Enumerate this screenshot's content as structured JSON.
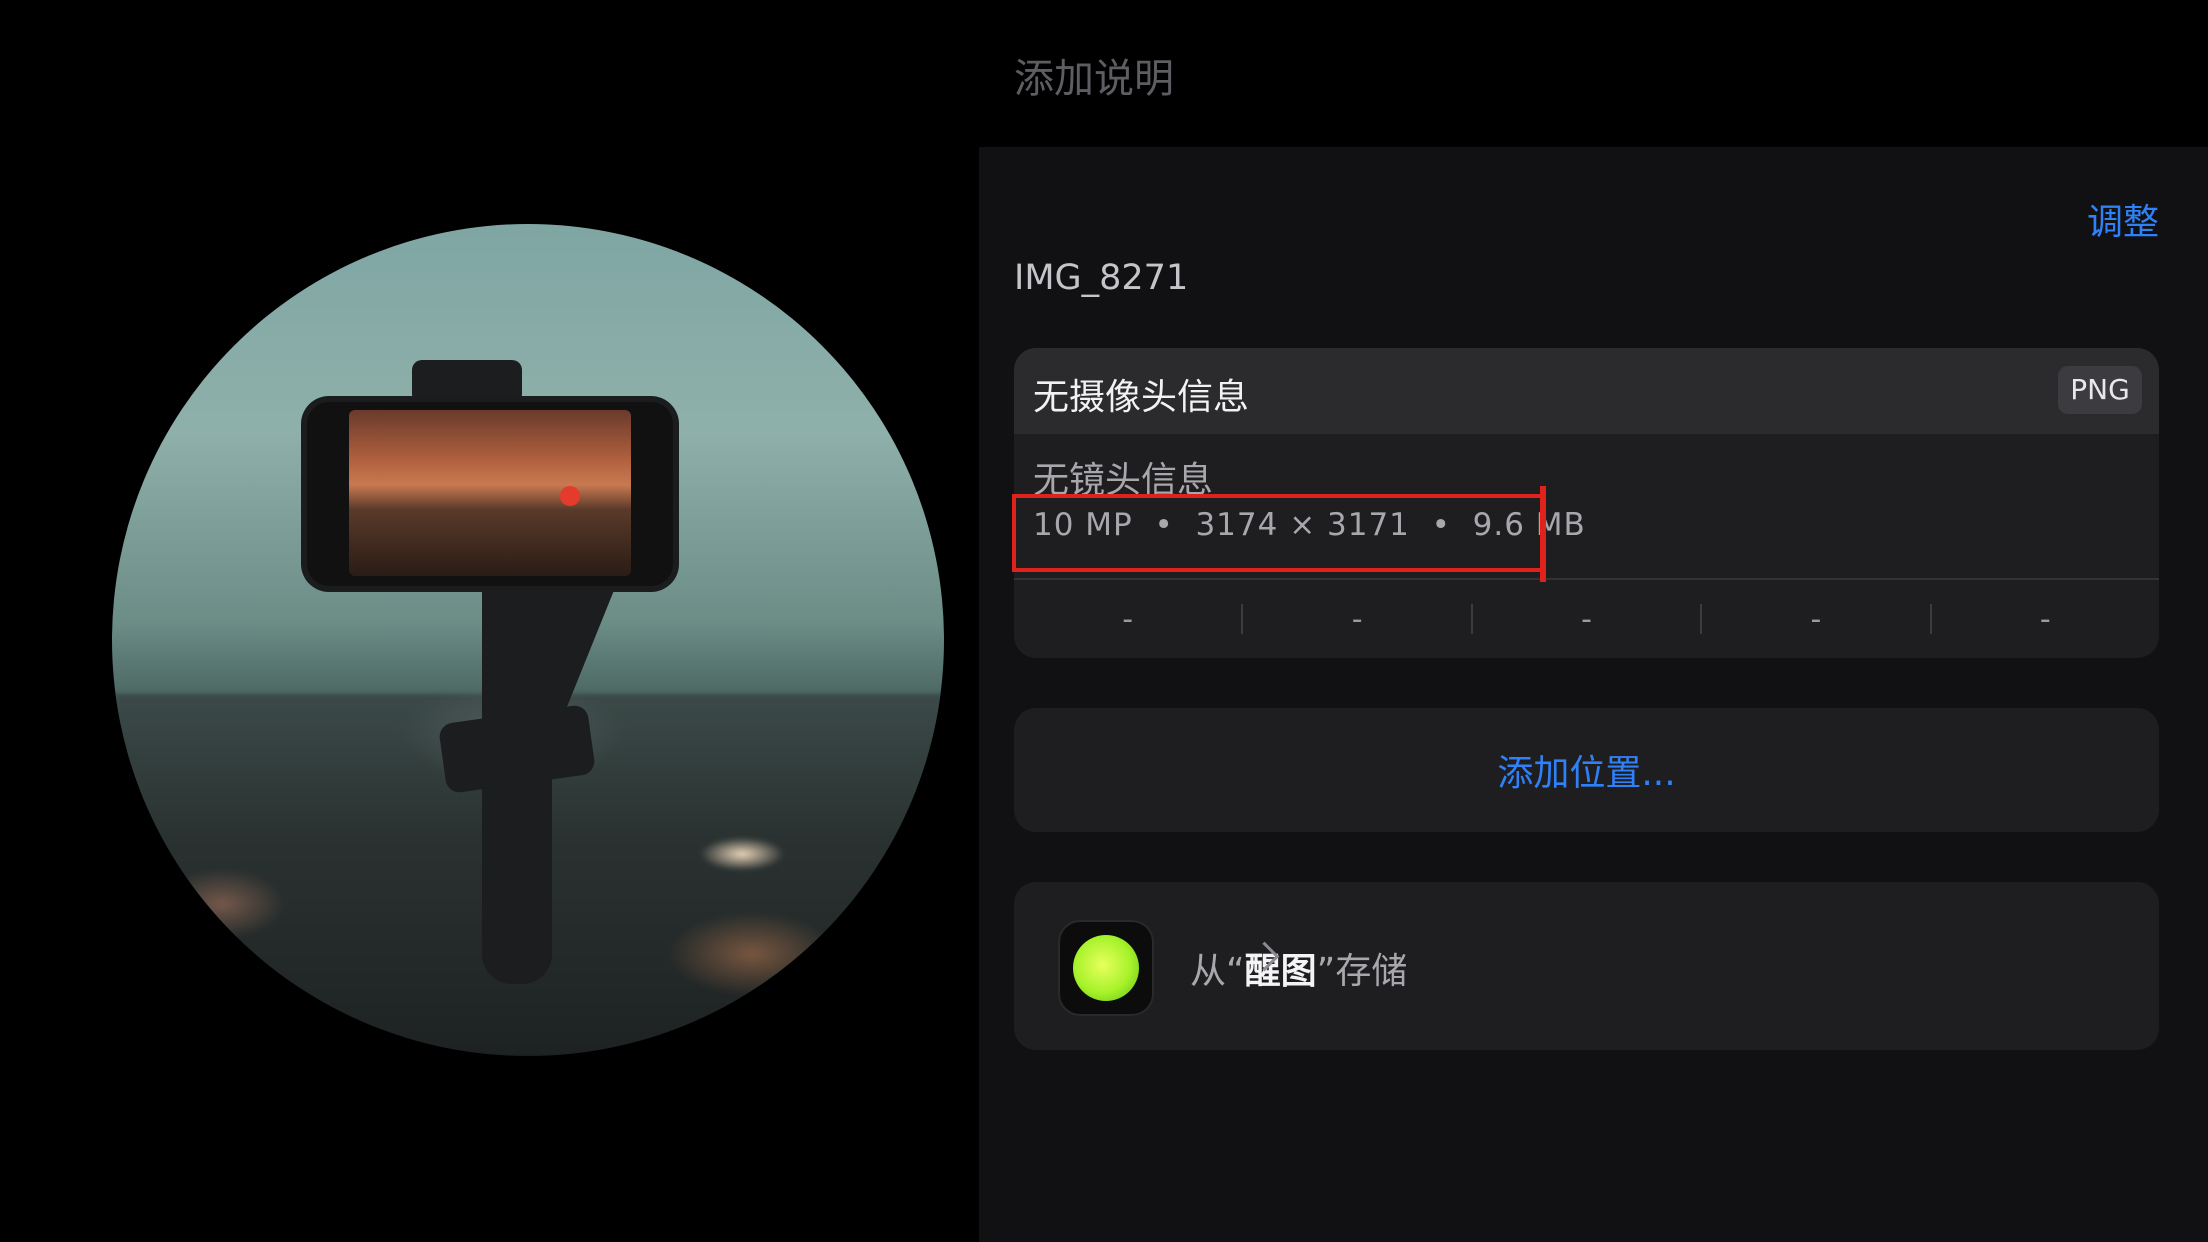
{
  "caption": {
    "placeholder": "添加说明"
  },
  "header": {
    "adjust_label": "调整"
  },
  "photo": {
    "filename": "IMG_8271"
  },
  "info": {
    "camera": "无摄像头信息",
    "format_badge": "PNG",
    "lens": "无镜头信息",
    "specs": "10 MP  •  3174 × 3171  •  9.6 MB",
    "exif": [
      "-",
      "-",
      "-",
      "-",
      "-"
    ]
  },
  "location": {
    "label": "添加位置..."
  },
  "source": {
    "prefix": "从“",
    "app_name": "醒图",
    "suffix": "”存储"
  },
  "colors": {
    "accent": "#2f81f7",
    "annotation": "#e0221c",
    "app_icon": "#a6f22a"
  }
}
